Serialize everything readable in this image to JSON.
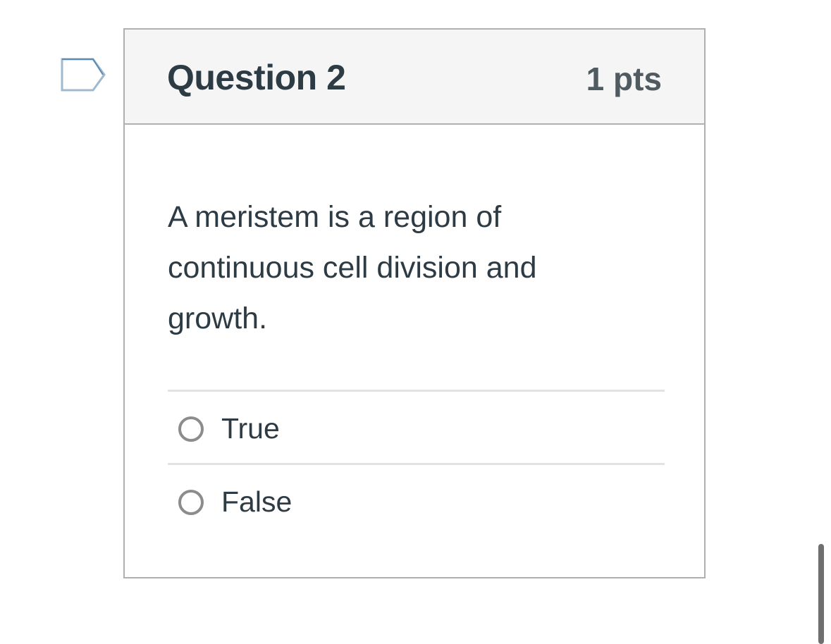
{
  "question": {
    "title": "Question 2",
    "points": "1 pts",
    "text": "A meristem is a region of continuous cell division and growth.",
    "answers": [
      {
        "label": "True",
        "selected": false
      },
      {
        "label": "False",
        "selected": false
      }
    ]
  },
  "icons": {
    "flag": "flag-question-icon",
    "radio": "radio-unchecked-icon"
  },
  "colors": {
    "text": "#2d3b45",
    "points": "#4f5a61",
    "flag_outline": "#5b8bb3",
    "header_background": "#f5f5f5",
    "border": "#b0b0b0",
    "divider": "#e2e2e2",
    "radio_border": "#8c8c8c"
  }
}
